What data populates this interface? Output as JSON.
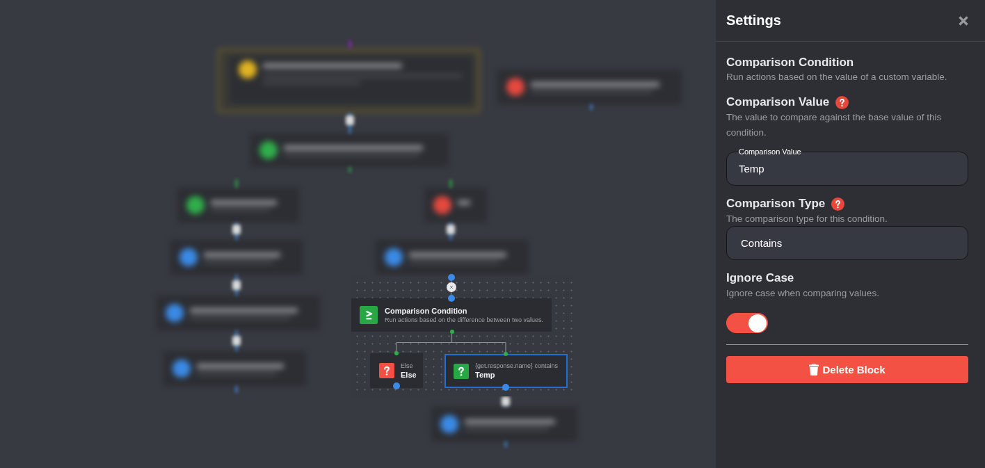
{
  "canvas": {
    "block": {
      "title": "Comparison Condition",
      "description": "Run actions based on the difference between two values."
    },
    "branches": [
      {
        "caption": "Else",
        "label": "Else",
        "color": "#f44f43",
        "selected": false
      },
      {
        "caption": "{get.response.name} contains",
        "label": "Temp",
        "color": "#28a745",
        "selected": true
      }
    ]
  },
  "settings": {
    "title": "Settings",
    "block": {
      "title": "Comparison Condition",
      "description": "Run actions based on the value of a custom variable."
    },
    "fields": [
      {
        "kind": "input",
        "label": "Comparison Value",
        "help": true,
        "description": "The value to compare against the base value of this condition.",
        "floating_label": "Comparison Value",
        "value": "Temp"
      },
      {
        "kind": "select",
        "label": "Comparison Type",
        "help": true,
        "description": "The comparison type for this condition.",
        "value": "Contains"
      },
      {
        "kind": "toggle",
        "label": "Ignore Case",
        "help": false,
        "description": "Ignore case when comparing values.",
        "on": true
      }
    ],
    "delete_button": "Delete Block"
  }
}
